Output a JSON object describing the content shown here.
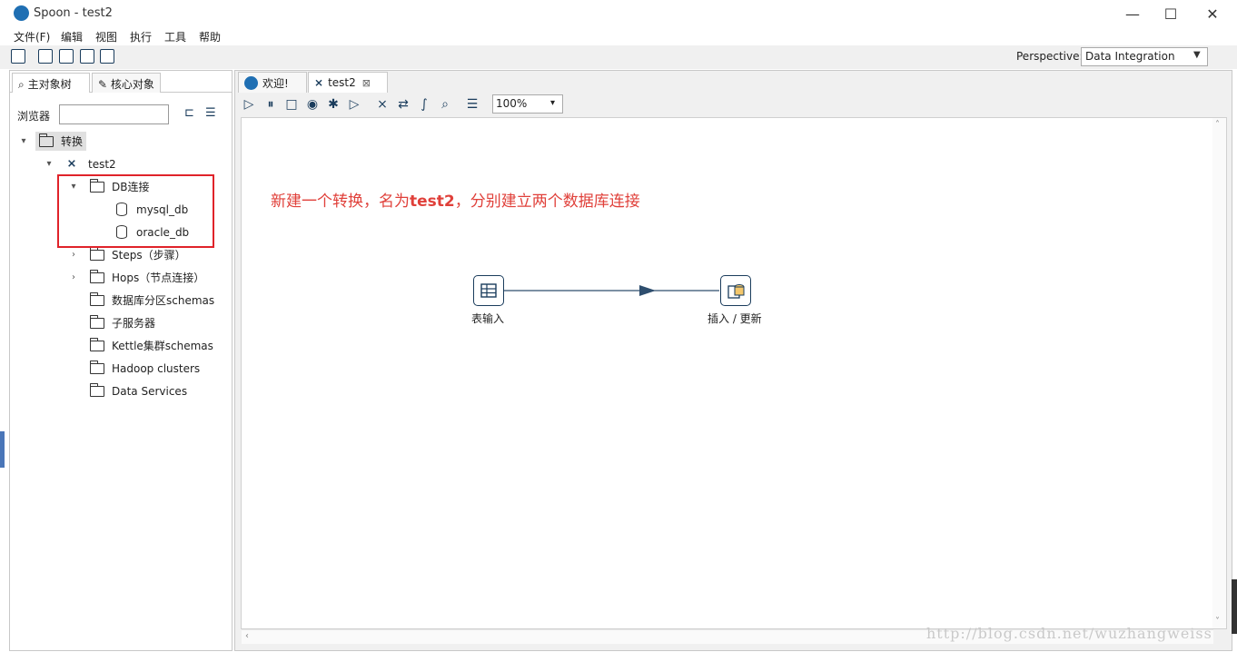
{
  "window": {
    "title": "Spoon - test2",
    "minimize": "—",
    "maximize": "☐",
    "close": "✕"
  },
  "menu": [
    "文件(F)",
    "编辑",
    "视图",
    "执行",
    "工具",
    "帮助"
  ],
  "toolbar": {
    "icons": [
      "new-file-icon",
      "open-folder-icon",
      "explore-repository-icon",
      "save-icon",
      "save-as-icon"
    ],
    "perspective_label": "Perspective:",
    "perspective_value": "Data Integration"
  },
  "left_panel": {
    "tabs": [
      "主对象树",
      "核心对象"
    ],
    "browser_label": "浏览器",
    "browser_placeholder": "",
    "tree": {
      "root": "转换",
      "transformation": "test2",
      "db_folder": "DB连接",
      "connections": [
        "mysql_db",
        "oracle_db"
      ],
      "folders": [
        "Steps（步骤）",
        "Hops（节点连接）",
        "数据库分区schemas",
        "子服务器",
        "Kettle集群schemas",
        "Hadoop clusters",
        "Data Services"
      ]
    }
  },
  "right_panel": {
    "tabs": [
      {
        "label": "欢迎!"
      },
      {
        "label": "test2",
        "close": "⊠"
      }
    ],
    "zoom": "100%",
    "annotation_pre": "新建一个转换，名为",
    "annotation_bold": "test2",
    "annotation_post": "，分别建立两个数据库连接",
    "steps": [
      {
        "label": "表输入",
        "icon": "table-input-icon"
      },
      {
        "label": "插入 / 更新",
        "icon": "insert-update-icon"
      }
    ]
  },
  "watermark": "http://blog.csdn.net/wuzhangweiss"
}
